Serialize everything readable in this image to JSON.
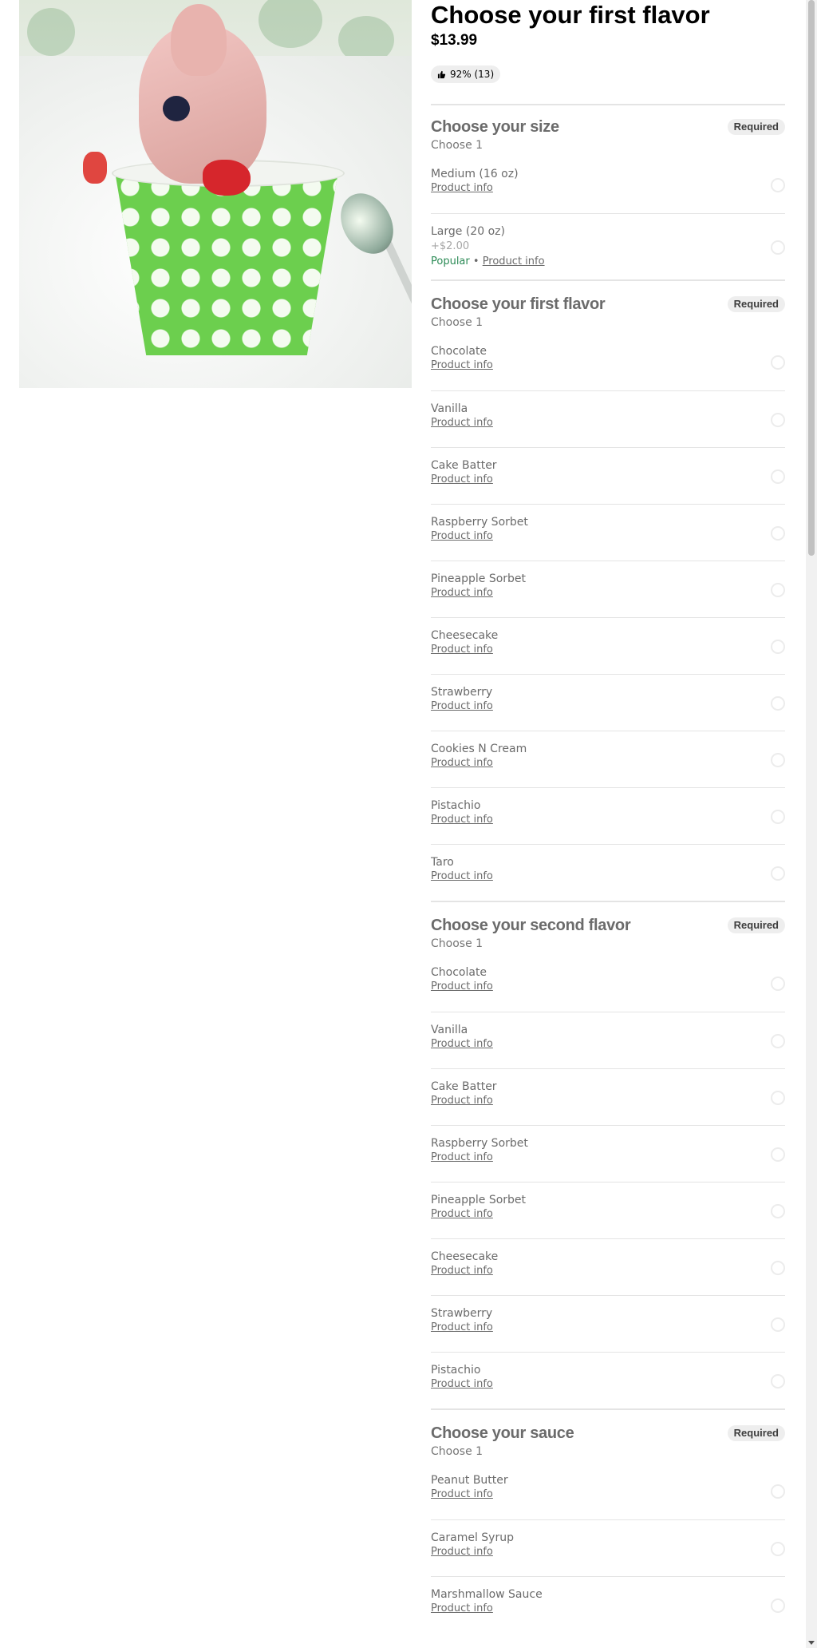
{
  "product": {
    "title": "Choose your first flavor",
    "price": "$13.99",
    "rating": "92% (13)",
    "image_alt": "Frozen yogurt cup"
  },
  "sections": [
    {
      "title": "Choose your size",
      "badge": "Required",
      "subtitle": "Choose 1",
      "options": [
        {
          "name": "Medium (16 oz)",
          "link": "Product info"
        },
        {
          "name": "Large (20 oz)",
          "extra": "+$2.00",
          "tag": "Popular",
          "separator": " • ",
          "link": "Product info"
        }
      ]
    },
    {
      "title": "Choose your first flavor",
      "badge": "Required",
      "subtitle": "Choose 1",
      "options": [
        {
          "name": "Chocolate",
          "link": "Product info"
        },
        {
          "name": "Vanilla",
          "link": "Product info"
        },
        {
          "name": "Cake Batter",
          "link": "Product info"
        },
        {
          "name": "Raspberry Sorbet",
          "link": "Product info"
        },
        {
          "name": "Pineapple Sorbet",
          "link": "Product info"
        },
        {
          "name": "Cheesecake",
          "link": "Product info"
        },
        {
          "name": "Strawberry",
          "link": "Product info"
        },
        {
          "name": "Cookies N Cream",
          "link": "Product info"
        },
        {
          "name": "Pistachio",
          "link": "Product info"
        },
        {
          "name": "Taro",
          "link": "Product info"
        }
      ]
    },
    {
      "title": "Choose your second flavor",
      "badge": "Required",
      "subtitle": "Choose 1",
      "options": [
        {
          "name": "Chocolate",
          "link": "Product info"
        },
        {
          "name": "Vanilla",
          "link": "Product info"
        },
        {
          "name": "Cake Batter",
          "link": "Product info"
        },
        {
          "name": "Raspberry Sorbet",
          "link": "Product info"
        },
        {
          "name": "Pineapple Sorbet",
          "link": "Product info"
        },
        {
          "name": "Cheesecake",
          "link": "Product info"
        },
        {
          "name": "Strawberry",
          "link": "Product info"
        },
        {
          "name": "Pistachio",
          "link": "Product info"
        }
      ]
    },
    {
      "title": "Choose your sauce",
      "badge": "Required",
      "subtitle": "Choose 1",
      "options": [
        {
          "name": "Peanut Butter",
          "link": "Product info"
        },
        {
          "name": "Caramel Syrup",
          "link": "Product info"
        },
        {
          "name": "Marshmallow Sauce",
          "link": "Product info"
        }
      ]
    }
  ],
  "colors": {
    "popular": "#2b8a55",
    "muted_text": "#6b6b6b",
    "badge_bg": "#eeeeee",
    "divider": "#e4e4e4"
  }
}
